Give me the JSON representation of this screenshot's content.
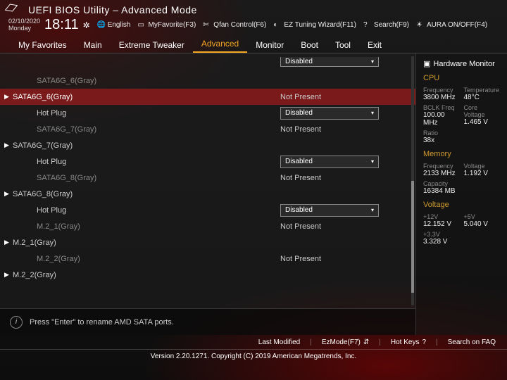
{
  "header": {
    "title": "UEFI BIOS Utility – Advanced Mode",
    "date": "02/10/2020",
    "day": "Monday",
    "time": "18:11",
    "toolbar": {
      "language": "English",
      "favorite": "MyFavorite(F3)",
      "qfan": "Qfan Control(F6)",
      "ez": "EZ Tuning Wizard(F11)",
      "search": "Search(F9)",
      "aura": "AURA ON/OFF(F4)"
    }
  },
  "tabs": [
    "My Favorites",
    "Main",
    "Extreme Tweaker",
    "Advanced",
    "Monitor",
    "Boot",
    "Tool",
    "Exit"
  ],
  "active_tab": "Advanced",
  "rows": [
    {
      "label": "SATA6G_6(Gray)",
      "type": "text",
      "value": "",
      "arrow": false,
      "indent": true,
      "dim": true
    },
    {
      "label": "SATA6G_6(Gray)",
      "type": "text",
      "value": "Not Present",
      "arrow": true,
      "sel": true
    },
    {
      "label": "Hot Plug",
      "type": "dropdown",
      "value": "Disabled",
      "indent": true
    },
    {
      "label": "SATA6G_7(Gray)",
      "type": "text",
      "value": "Not Present",
      "indent": true,
      "dim": true
    },
    {
      "label": "SATA6G_7(Gray)",
      "type": "text",
      "value": "",
      "arrow": true
    },
    {
      "label": "Hot Plug",
      "type": "dropdown",
      "value": "Disabled",
      "indent": true
    },
    {
      "label": "SATA6G_8(Gray)",
      "type": "text",
      "value": "Not Present",
      "indent": true,
      "dim": true
    },
    {
      "label": "SATA6G_8(Gray)",
      "type": "text",
      "value": "",
      "arrow": true
    },
    {
      "label": "Hot Plug",
      "type": "dropdown",
      "value": "Disabled",
      "indent": true
    },
    {
      "label": "M.2_1(Gray)",
      "type": "text",
      "value": "Not Present",
      "indent": true,
      "dim": true
    },
    {
      "label": "M.2_1(Gray)",
      "type": "text",
      "value": "",
      "arrow": true
    },
    {
      "label": "M.2_2(Gray)",
      "type": "text",
      "value": "Not Present",
      "indent": true,
      "dim": true
    },
    {
      "label": "M.2_2(Gray)",
      "type": "text",
      "value": "",
      "arrow": true
    }
  ],
  "top_partial_dropdown": "Disabled",
  "help_text": "Press \"Enter\" to rename AMD SATA ports.",
  "side": {
    "title": "Hardware Monitor",
    "cpu": {
      "heading": "CPU",
      "freq_k": "Frequency",
      "freq_v": "3800 MHz",
      "temp_k": "Temperature",
      "temp_v": "48°C",
      "bclk_k": "BCLK Freq",
      "bclk_v": "100.00 MHz",
      "cv_k": "Core Voltage",
      "cv_v": "1.465 V",
      "ratio_k": "Ratio",
      "ratio_v": "38x"
    },
    "mem": {
      "heading": "Memory",
      "freq_k": "Frequency",
      "freq_v": "2133 MHz",
      "volt_k": "Voltage",
      "volt_v": "1.192 V",
      "cap_k": "Capacity",
      "cap_v": "16384 MB"
    },
    "volt": {
      "heading": "Voltage",
      "p12_k": "+12V",
      "p12_v": "12.152 V",
      "p5_k": "+5V",
      "p5_v": "5.040 V",
      "p33_k": "+3.3V",
      "p33_v": "3.328 V"
    }
  },
  "footer": {
    "links": [
      "Last Modified",
      "EzMode(F7)",
      "Hot Keys",
      "Search on FAQ"
    ],
    "copyright": "Version 2.20.1271. Copyright (C) 2019 American Megatrends, Inc."
  }
}
